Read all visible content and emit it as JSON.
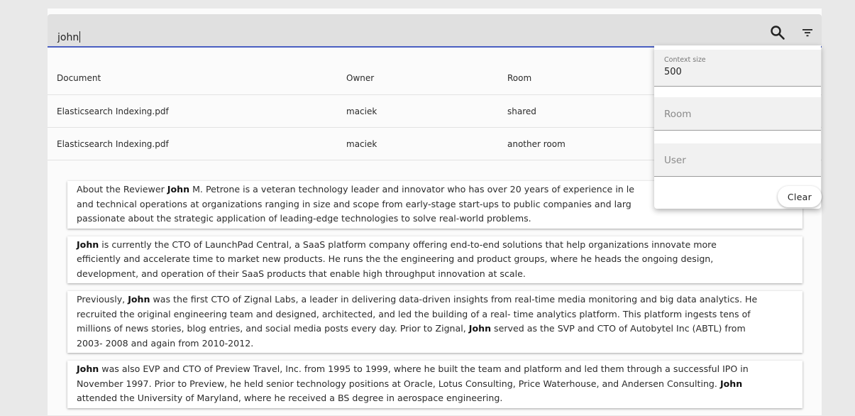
{
  "search": {
    "query": "john"
  },
  "icons": {
    "search": "search-icon",
    "filter": "filter-icon"
  },
  "table": {
    "headers": [
      "Document",
      "Owner",
      "Room"
    ],
    "rows": [
      {
        "document": "Elasticsearch Indexing.pdf",
        "owner": "maciek",
        "room": "shared"
      },
      {
        "document": "Elasticsearch Indexing.pdf",
        "owner": "maciek",
        "room": "another room"
      }
    ]
  },
  "filters": {
    "context_label": "Context size",
    "context_value": "500",
    "room_placeholder": "Room",
    "user_placeholder": "User",
    "clear_label": "Clear"
  },
  "snippets": [
    [
      {
        "t": "About the Reviewer "
      },
      {
        "t": "John",
        "b": true
      },
      {
        "t": " M. Petrone is a veteran technology leader and innovator who has over 20 years of experience in le"
      },
      {
        "t": "\nand technical operations at organizations ranging in size and scope from early-stage start-ups to public companies and larg"
      },
      {
        "t": "\npassionate about the strategic application of leading-edge technologies to solve real-world problems."
      }
    ],
    [
      {
        "t": "John",
        "b": true
      },
      {
        "t": " is currently the CTO of LaunchPad Central, a SaaS platform company offering end-to-end solutions that help organizations innovate more"
      },
      {
        "t": "\nefficiently and accelerate time to market new products. He runs the the engineering and product groups, where he heads the ongoing design,"
      },
      {
        "t": "\ndevelopment, and operation of their SaaS products that enable high throughput innovation at scale."
      }
    ],
    [
      {
        "t": "Previously, "
      },
      {
        "t": "John",
        "b": true
      },
      {
        "t": " was the first CTO of Zignal Labs, a leader in delivering data-driven insights from real-time media monitoring and big data analytics. He"
      },
      {
        "t": "\nrecruited the original engineering team and designed, architected, and led the building of a real- time analytics platform. This platform ingests tens of"
      },
      {
        "t": "\nmillions of news stories, blog entries, and social media posts every day. Prior to Zignal, "
      },
      {
        "t": "John",
        "b": true
      },
      {
        "t": " served as the SVP and CTO of Autobytel Inc (ABTL) from"
      },
      {
        "t": "\n2003- 2008 and again from 2010-2012."
      }
    ],
    [
      {
        "t": "John",
        "b": true
      },
      {
        "t": " was also EVP and CTO of Preview Travel, Inc. from 1995 to 1999, where he built the team and platform and led them through a successful IPO in"
      },
      {
        "t": "\nNovember 1997. Prior to Preview, he held senior technology positions at Oracle, Lotus Consulting, Price Waterhouse, and Andersen Consulting. "
      },
      {
        "t": "John",
        "b": true
      },
      {
        "t": "\nattended the University of Maryland, where he received a BS degree in aerospace engineering."
      }
    ]
  ]
}
